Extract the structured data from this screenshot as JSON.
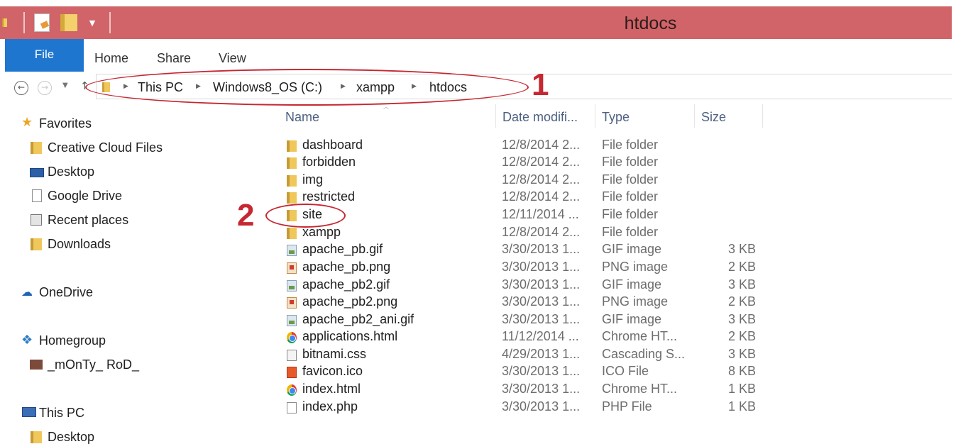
{
  "window": {
    "title": "htdocs",
    "accent_color": "#d06468",
    "file_tab_color": "#1e76cf"
  },
  "ribbon": {
    "tabs": [
      "File",
      "Home",
      "Share",
      "View"
    ]
  },
  "address": {
    "breadcrumbs": [
      "This PC",
      "Windows8_OS (C:)",
      "xampp",
      "htdocs"
    ]
  },
  "annotations": {
    "marker1": "1",
    "marker2": "2",
    "color": "#c62832"
  },
  "nav": {
    "favorites": {
      "label": "Favorites",
      "items": [
        "Creative Cloud Files",
        "Desktop",
        "Google Drive",
        "Recent places",
        "Downloads"
      ]
    },
    "onedrive": "OneDrive",
    "homegroup": {
      "label": "Homegroup",
      "items": [
        "_mOnTy_ RoD_"
      ]
    },
    "thispc": {
      "label": "This PC",
      "items": [
        "Desktop"
      ]
    }
  },
  "columns": {
    "name": "Name",
    "date": "Date modifi...",
    "type": "Type",
    "size": "Size"
  },
  "files": [
    {
      "name": "dashboard",
      "date": "12/8/2014 2...",
      "type": "File folder",
      "size": "",
      "icon": "folder-icon"
    },
    {
      "name": "forbidden",
      "date": "12/8/2014 2...",
      "type": "File folder",
      "size": "",
      "icon": "folder-icon"
    },
    {
      "name": "img",
      "date": "12/8/2014 2...",
      "type": "File folder",
      "size": "",
      "icon": "folder-icon"
    },
    {
      "name": "restricted",
      "date": "12/8/2014 2...",
      "type": "File folder",
      "size": "",
      "icon": "folder-icon"
    },
    {
      "name": "site",
      "date": "12/11/2014 ...",
      "type": "File folder",
      "size": "",
      "icon": "folder-icon"
    },
    {
      "name": "xampp",
      "date": "12/8/2014 2...",
      "type": "File folder",
      "size": "",
      "icon": "folder-icon"
    },
    {
      "name": "apache_pb.gif",
      "date": "3/30/2013 1...",
      "type": "GIF image",
      "size": "3 KB",
      "icon": "gif-image-icon"
    },
    {
      "name": "apache_pb.png",
      "date": "3/30/2013 1...",
      "type": "PNG image",
      "size": "2 KB",
      "icon": "png-image-icon"
    },
    {
      "name": "apache_pb2.gif",
      "date": "3/30/2013 1...",
      "type": "GIF image",
      "size": "3 KB",
      "icon": "gif-image-icon"
    },
    {
      "name": "apache_pb2.png",
      "date": "3/30/2013 1...",
      "type": "PNG image",
      "size": "2 KB",
      "icon": "png-image-icon"
    },
    {
      "name": "apache_pb2_ani.gif",
      "date": "3/30/2013 1...",
      "type": "GIF image",
      "size": "3 KB",
      "icon": "gif-image-icon"
    },
    {
      "name": "applications.html",
      "date": "11/12/2014 ...",
      "type": "Chrome HT...",
      "size": "2 KB",
      "icon": "chrome-icon"
    },
    {
      "name": "bitnami.css",
      "date": "4/29/2013 1...",
      "type": "Cascading S...",
      "size": "3 KB",
      "icon": "css-file-icon"
    },
    {
      "name": "favicon.ico",
      "date": "3/30/2013 1...",
      "type": "ICO File",
      "size": "8 KB",
      "icon": "ico-file-icon"
    },
    {
      "name": "index.html",
      "date": "3/30/2013 1...",
      "type": "Chrome HT...",
      "size": "1 KB",
      "icon": "chrome-icon"
    },
    {
      "name": "index.php",
      "date": "3/30/2013 1...",
      "type": "PHP File",
      "size": "1 KB",
      "icon": "php-file-icon"
    }
  ]
}
